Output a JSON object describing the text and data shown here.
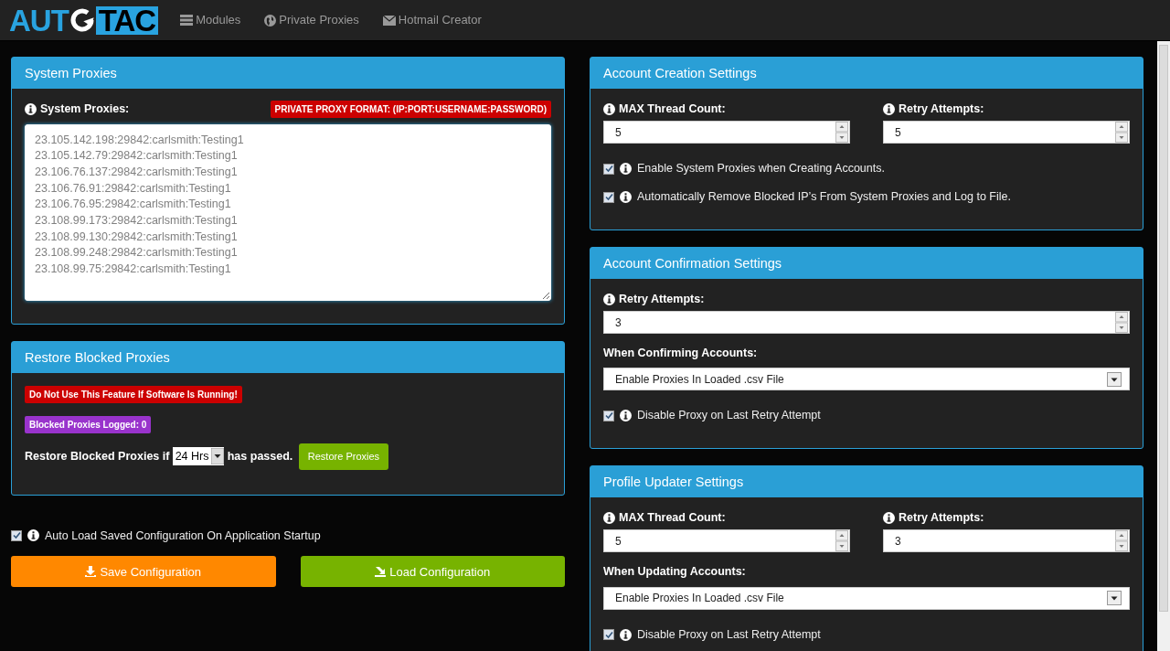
{
  "navbar": {
    "logo": {
      "left": "AUT",
      "right": "TAC"
    },
    "links": [
      {
        "label": "Modules"
      },
      {
        "label": "Private Proxies"
      },
      {
        "label": "Hotmail Creator"
      }
    ]
  },
  "system_proxies": {
    "title": "System Proxies",
    "label": "System Proxies:",
    "format_badge": "PRIVATE PROXY FORMAT: (IP:PORT:USERNAME:PASSWORD)",
    "proxies": [
      "23.105.142.198:29842:carlsmith:Testing1",
      "23.105.142.79:29842:carlsmith:Testing1",
      "23.106.76.137:29842:carlsmith:Testing1",
      "23.106.76.91:29842:carlsmith:Testing1",
      "23.106.76.95:29842:carlsmith:Testing1",
      "23.108.99.173:29842:carlsmith:Testing1",
      "23.108.99.130:29842:carlsmith:Testing1",
      "23.108.99.248:29842:carlsmith:Testing1",
      "23.108.99.75:29842:carlsmith:Testing1"
    ]
  },
  "restore_blocked": {
    "title": "Restore Blocked Proxies",
    "badges": [
      {
        "text": "Do Not Use This Feature If Software Is Running!",
        "color": "#cc0000"
      },
      {
        "text": "Blocked Proxies Logged: 0",
        "color": "#9933cc"
      }
    ],
    "prefix": "Restore Blocked Proxies if",
    "interval": "24 Hrs",
    "suffix": "has passed.",
    "button": "Restore Proxies"
  },
  "auto_load": {
    "label": "Auto Load Saved Configuration On Application Startup",
    "checked": true
  },
  "buttons": [
    {
      "label": "Save Configuration",
      "kind": "save"
    },
    {
      "label": "Load Configuration",
      "kind": "load"
    }
  ],
  "panels": [
    {
      "title": "Account Creation Settings",
      "items": [
        {
          "kind": "number_pair",
          "fields": [
            {
              "label": "MAX Thread Count:",
              "value": "5"
            },
            {
              "label": "Retry Attempts:",
              "value": "5"
            }
          ]
        },
        {
          "kind": "checkbox",
          "label": "Enable System Proxies when Creating Accounts.",
          "checked": true
        },
        {
          "kind": "checkbox",
          "label": "Automatically Remove Blocked IP’s From System Proxies and Log to File.",
          "checked": true
        }
      ]
    },
    {
      "title": "Account Confirmation Settings",
      "items": [
        {
          "kind": "number",
          "label": "Retry Attempts:",
          "value": "3"
        },
        {
          "kind": "select",
          "label": "When Confirming Accounts:",
          "value": "Enable Proxies In Loaded .csv File"
        },
        {
          "kind": "checkbox",
          "label": "Disable Proxy on Last Retry Attempt",
          "checked": true
        }
      ]
    },
    {
      "title": "Profile Updater Settings",
      "items": [
        {
          "kind": "number_pair",
          "fields": [
            {
              "label": "MAX Thread Count:",
              "value": "5"
            },
            {
              "label": "Retry Attempts:",
              "value": "3"
            }
          ]
        },
        {
          "kind": "select",
          "label": "When Updating Accounts:",
          "value": "Enable Proxies In Loaded .csv File"
        },
        {
          "kind": "checkbox",
          "label": "Disable Proxy on Last Retry Attempt",
          "checked": true
        }
      ]
    }
  ]
}
